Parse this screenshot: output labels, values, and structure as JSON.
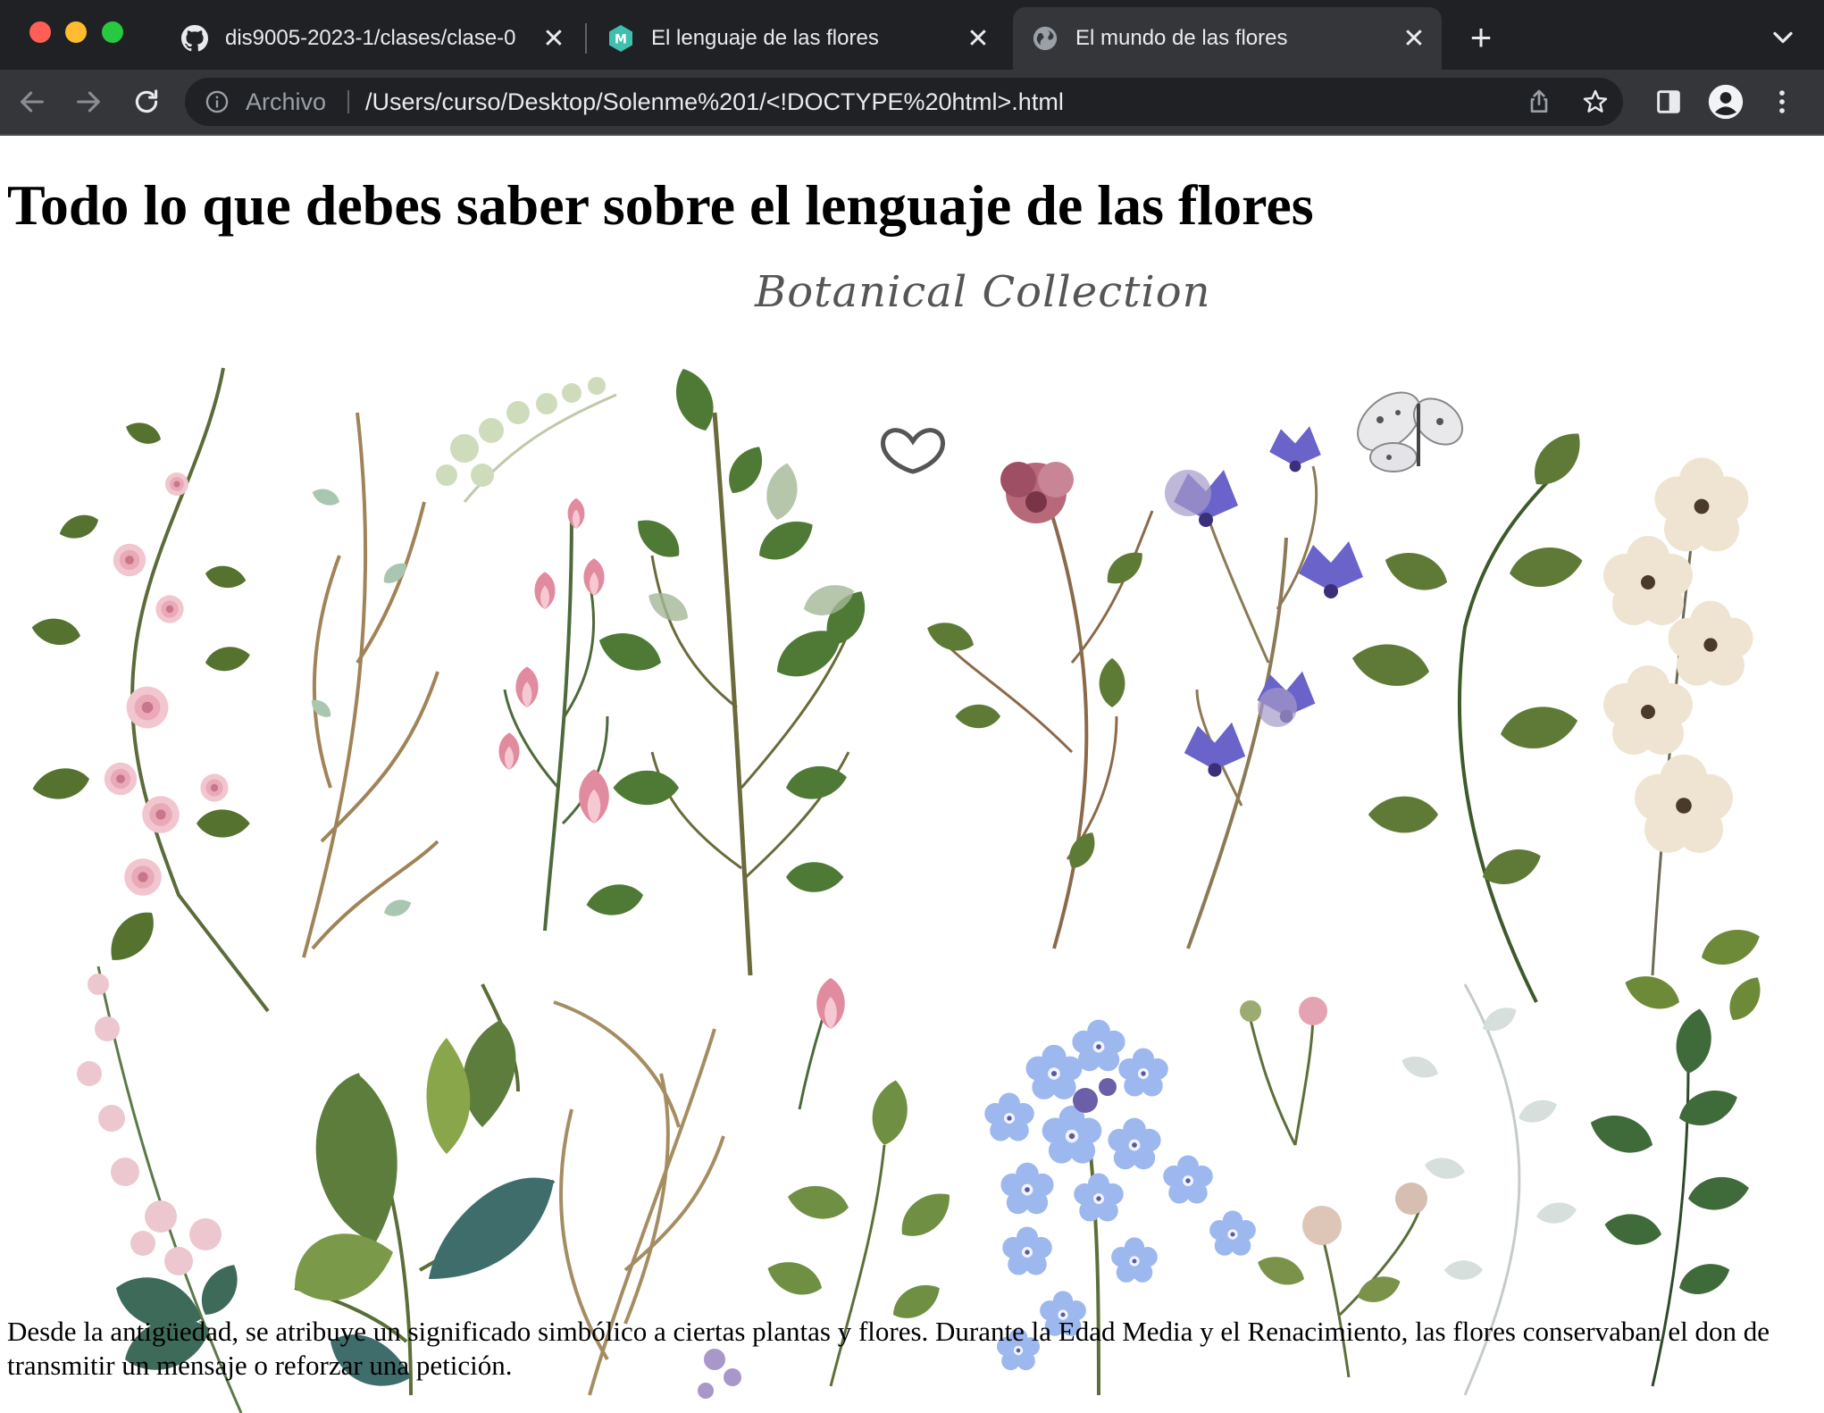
{
  "browser": {
    "tabs": [
      {
        "title": "dis9005-2023-1/clases/clase-0",
        "favicon": "github-icon",
        "active": false
      },
      {
        "title": "El lenguaje de las flores",
        "favicon": "site-m-icon",
        "active": false
      },
      {
        "title": "El mundo de las flores",
        "favicon": "globe-icon",
        "active": true
      }
    ],
    "address_bar": {
      "scheme_label": "Archivo",
      "url": "/Users/curso/Desktop/Solenme%201/<!DOCTYPE%20html>.html"
    }
  },
  "page": {
    "title": "Todo lo que debes saber sobre el lenguaje de las flores",
    "image": {
      "title_text": "Botanical Collection",
      "kind": "watercolor botanical illustration"
    },
    "intro": "Desde la antigüedad, se atribuye un significado simbólico a ciertas plantas y flores. Durante la Edad Media y el Renacimiento, las flores conservaban el don de transmitir un mensaje o reforzar una petición."
  },
  "colors": {
    "chrome_dark": "#202124",
    "chrome_toolbar": "#35363a",
    "chrome_text": "#e8eaed",
    "leaf_green": "#5a7a3a",
    "rose_pink": "#e8a7b5",
    "forget_me_not_blue": "#8aa9e8",
    "bellflower_purple": "#6a5fc8"
  }
}
